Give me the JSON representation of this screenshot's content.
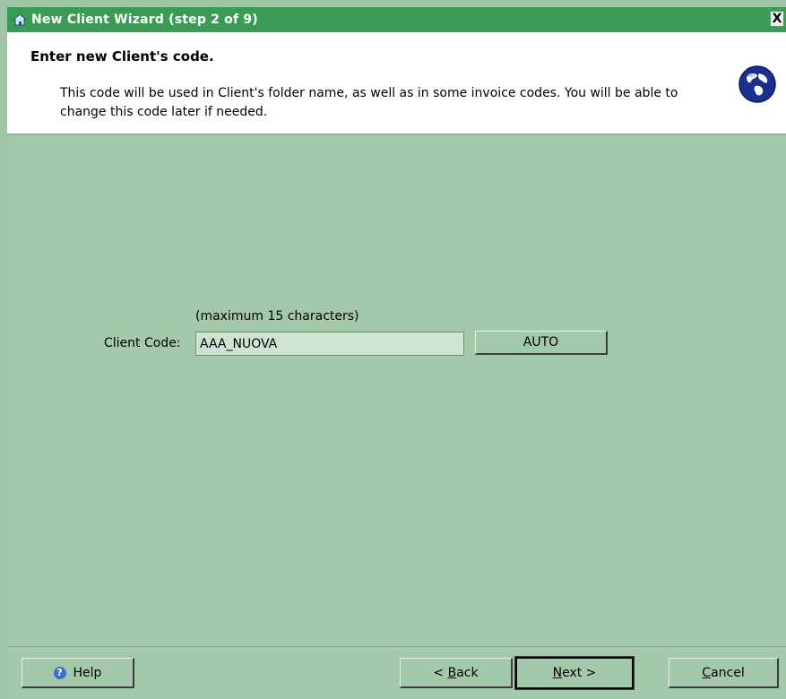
{
  "window": {
    "title": "New Client Wizard  (step 2 of 9)",
    "close_label": "X"
  },
  "header": {
    "title": "Enter new Client's code.",
    "description": "This code will be used in Client's folder name, as well as in some invoice codes. You will be able to change this code later if needed."
  },
  "form": {
    "hint": "(maximum 15 characters)",
    "client_code_label": "Client Code:",
    "client_code_value": "AAA_NUOVA",
    "auto_button": "AUTO"
  },
  "footer": {
    "help_label": "Help",
    "back_prefix": "< ",
    "back_mnemonic": "B",
    "back_rest": "ack",
    "next_mnemonic": "N",
    "next_rest": "ext >",
    "cancel_mnemonic": "C",
    "cancel_rest": "ancel"
  },
  "icons": {
    "window_icon": "home-icon",
    "header_icon": "globe-icon",
    "help_icon": "question-icon"
  },
  "colors": {
    "titlebar": "#3b9b55",
    "background": "#a4c8aa",
    "input": "#cfe3d3"
  }
}
